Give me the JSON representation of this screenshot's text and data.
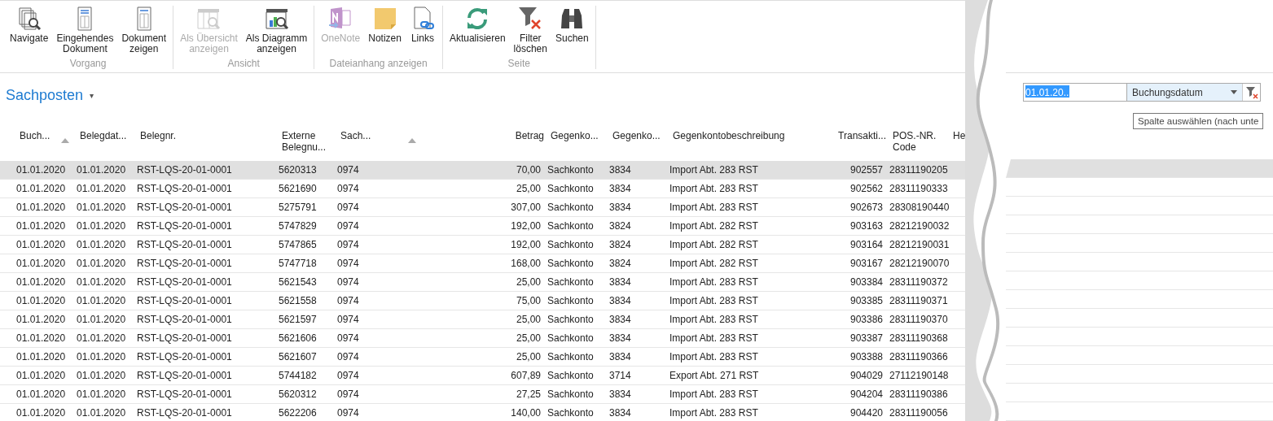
{
  "ribbon": {
    "groups": [
      {
        "label": "Vorgang",
        "buttons": [
          {
            "lines": [
              "Navigate"
            ],
            "disabled": false
          },
          {
            "lines": [
              "Eingehendes",
              "Dokument"
            ],
            "disabled": false
          },
          {
            "lines": [
              "Dokument",
              "zeigen"
            ],
            "disabled": false
          }
        ]
      },
      {
        "label": "Ansicht",
        "buttons": [
          {
            "lines": [
              "Als Übersicht",
              "anzeigen"
            ],
            "disabled": true
          },
          {
            "lines": [
              "Als Diagramm",
              "anzeigen"
            ],
            "disabled": false
          }
        ]
      },
      {
        "label": "Dateianhang anzeigen",
        "buttons": [
          {
            "lines": [
              "OneNote"
            ],
            "disabled": true
          },
          {
            "lines": [
              "Notizen"
            ],
            "disabled": false
          },
          {
            "lines": [
              "Links"
            ],
            "disabled": false
          }
        ]
      },
      {
        "label": "Seite",
        "buttons": [
          {
            "lines": [
              "Aktualisieren"
            ],
            "disabled": false
          },
          {
            "lines": [
              "Filter",
              "löschen"
            ],
            "disabled": false
          },
          {
            "lines": [
              "Suchen"
            ],
            "disabled": false
          }
        ]
      }
    ]
  },
  "page": {
    "title": "Sachposten",
    "caret": "▾"
  },
  "table": {
    "columns": [
      {
        "lines": [
          "Buch..."
        ],
        "sorted": true
      },
      {
        "lines": [
          "Belegdat..."
        ],
        "sorted": false
      },
      {
        "lines": [
          "Belegnr."
        ],
        "sorted": false
      },
      {
        "lines": [
          "Externe",
          "Belegnu..."
        ],
        "sorted": false
      },
      {
        "lines": [
          "Sach..."
        ],
        "sorted": true
      },
      {
        "lines": [
          "Betrag"
        ],
        "sorted": false
      },
      {
        "lines": [
          "Gegenko..."
        ],
        "sorted": false
      },
      {
        "lines": [
          "Gegenko..."
        ],
        "sorted": false
      },
      {
        "lines": [
          "Gegenkontobeschreibung"
        ],
        "sorted": false
      },
      {
        "lines": [
          "Transakti..."
        ],
        "sorted": false
      },
      {
        "lines": [
          "POS.-NR.",
          "Code"
        ],
        "sorted": false
      },
      {
        "lines": [
          "He"
        ],
        "sorted": false
      }
    ],
    "rows": [
      {
        "selected": true,
        "cells": [
          "01.01.2020",
          "01.01.2020",
          "RST-LQS-20-01-0001",
          "5620313",
          "0974",
          "70,00",
          "Sachkonto",
          "3834",
          "Import Abt. 283 RST",
          "902557",
          "28311190205"
        ]
      },
      {
        "selected": false,
        "cells": [
          "01.01.2020",
          "01.01.2020",
          "RST-LQS-20-01-0001",
          "5621690",
          "0974",
          "25,00",
          "Sachkonto",
          "3834",
          "Import Abt. 283 RST",
          "902562",
          "28311190333"
        ]
      },
      {
        "selected": false,
        "cells": [
          "01.01.2020",
          "01.01.2020",
          "RST-LQS-20-01-0001",
          "5275791",
          "0974",
          "307,00",
          "Sachkonto",
          "3834",
          "Import Abt. 283 RST",
          "902673",
          "28308190440"
        ]
      },
      {
        "selected": false,
        "cells": [
          "01.01.2020",
          "01.01.2020",
          "RST-LQS-20-01-0001",
          "5747829",
          "0974",
          "192,00",
          "Sachkonto",
          "3824",
          "Import Abt. 282 RST",
          "903163",
          "28212190032"
        ]
      },
      {
        "selected": false,
        "cells": [
          "01.01.2020",
          "01.01.2020",
          "RST-LQS-20-01-0001",
          "5747865",
          "0974",
          "192,00",
          "Sachkonto",
          "3824",
          "Import Abt. 282 RST",
          "903164",
          "28212190031"
        ]
      },
      {
        "selected": false,
        "cells": [
          "01.01.2020",
          "01.01.2020",
          "RST-LQS-20-01-0001",
          "5747718",
          "0974",
          "168,00",
          "Sachkonto",
          "3824",
          "Import Abt. 282 RST",
          "903167",
          "28212190070"
        ]
      },
      {
        "selected": false,
        "cells": [
          "01.01.2020",
          "01.01.2020",
          "RST-LQS-20-01-0001",
          "5621543",
          "0974",
          "25,00",
          "Sachkonto",
          "3834",
          "Import Abt. 283 RST",
          "903384",
          "28311190372"
        ]
      },
      {
        "selected": false,
        "cells": [
          "01.01.2020",
          "01.01.2020",
          "RST-LQS-20-01-0001",
          "5621558",
          "0974",
          "75,00",
          "Sachkonto",
          "3834",
          "Import Abt. 283 RST",
          "903385",
          "28311190371"
        ]
      },
      {
        "selected": false,
        "cells": [
          "01.01.2020",
          "01.01.2020",
          "RST-LQS-20-01-0001",
          "5621597",
          "0974",
          "25,00",
          "Sachkonto",
          "3834",
          "Import Abt. 283 RST",
          "903386",
          "28311190370"
        ]
      },
      {
        "selected": false,
        "cells": [
          "01.01.2020",
          "01.01.2020",
          "RST-LQS-20-01-0001",
          "5621606",
          "0974",
          "25,00",
          "Sachkonto",
          "3834",
          "Import Abt. 283 RST",
          "903387",
          "28311190368"
        ]
      },
      {
        "selected": false,
        "cells": [
          "01.01.2020",
          "01.01.2020",
          "RST-LQS-20-01-0001",
          "5621607",
          "0974",
          "25,00",
          "Sachkonto",
          "3834",
          "Import Abt. 283 RST",
          "903388",
          "28311190366"
        ]
      },
      {
        "selected": false,
        "cells": [
          "01.01.2020",
          "01.01.2020",
          "RST-LQS-20-01-0001",
          "5744182",
          "0974",
          "607,89",
          "Sachkonto",
          "3714",
          "Export Abt. 271 RST",
          "904029",
          "27112190148"
        ]
      },
      {
        "selected": false,
        "cells": [
          "01.01.2020",
          "01.01.2020",
          "RST-LQS-20-01-0001",
          "5620312",
          "0974",
          "27,25",
          "Sachkonto",
          "3834",
          "Import Abt. 283 RST",
          "904204",
          "28311190386"
        ]
      },
      {
        "selected": false,
        "cells": [
          "01.01.2020",
          "01.01.2020",
          "RST-LQS-20-01-0001",
          "5622206",
          "0974",
          "140,00",
          "Sachkonto",
          "3834",
          "Import Abt. 283 RST",
          "904420",
          "28311190056"
        ]
      }
    ]
  },
  "filter": {
    "value": "01.01.20..",
    "column": "Buchungsdatum",
    "tooltip": "Spalte auswählen (nach unte"
  }
}
